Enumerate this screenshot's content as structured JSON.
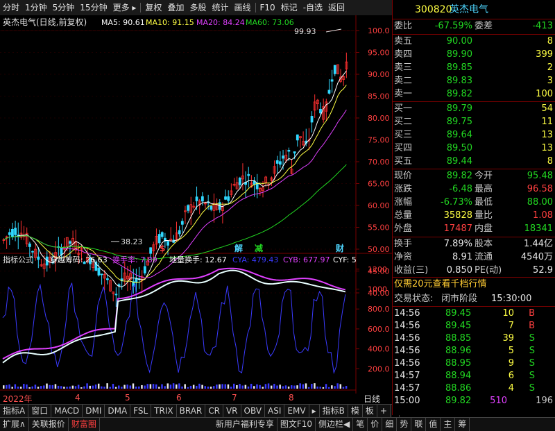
{
  "topbar": {
    "items": [
      "分时",
      "1分钟",
      "5分钟",
      "15分钟",
      "更多 ▸",
      "复权",
      "叠加",
      "多股",
      "统计",
      "画线",
      "F10",
      "标记",
      "-自选",
      "返回"
    ]
  },
  "chart": {
    "title": "英杰电气(日线,前复权)",
    "ma": [
      {
        "label": "MA5: 90.61",
        "color": "#ffffff"
      },
      {
        "label": "MA10: 91.15",
        "color": "#ffff44"
      },
      {
        "label": "MA20: 84.24",
        "color": "#e040ff"
      },
      {
        "label": "MA60: 73.06",
        "color": "#22d822"
      }
    ],
    "price_ticks": [
      "100.0",
      "95.00",
      "90.00",
      "85.00",
      "80.00",
      "75.00",
      "70.00",
      "65.00",
      "60.00",
      "55.00",
      "50.00",
      "45.00",
      "40.00"
    ],
    "high_note": "99.93",
    "low_note": "38.23",
    "markers": [
      {
        "text": "$",
        "color": "#ff4040"
      },
      {
        "text": "解",
        "color": "#4ed6ff"
      },
      {
        "text": "减",
        "color": "#22d822"
      },
      {
        "text": "财",
        "color": "#4ed6ff"
      }
    ],
    "indicator": {
      "name": "指标公式",
      "values": [
        {
          "label": "穿越筹码: 26.63",
          "color": "#ffffff"
        },
        {
          "label": "换手率:  7.89",
          "color": "#e040ff"
        },
        {
          "label": "地量换手: 12.67",
          "color": "#ffffff"
        },
        {
          "label": "CYA: 479.43",
          "color": "#3a3aff"
        },
        {
          "label": "CYB: 677.97",
          "color": "#e040ff"
        },
        {
          "label": "CYF: 5",
          "color": "#ffffff"
        }
      ],
      "ticks": [
        "1200",
        "1000",
        "800.0",
        "600.0",
        "400.0",
        "200.0"
      ]
    },
    "date_labels": [
      "2022年",
      "4",
      "5",
      "6",
      "7",
      "8"
    ],
    "period_label": "日线"
  },
  "tabs1": [
    "指标A",
    "窗口",
    "MACD",
    "DMI",
    "DMA",
    "FSL",
    "TRIX",
    "BRAR",
    "CR",
    "VR",
    "OBV",
    "ASI",
    "EMV",
    "▸",
    "指标B",
    "模",
    "板",
    "+",
    "-"
  ],
  "tabs2": [
    "扩展∧",
    "关联报价",
    "财富圈",
    "新用户福利专享",
    "图文F10",
    "侧边栏◀",
    "笔",
    "价",
    "细",
    "势",
    "联",
    "值",
    "主",
    "筹"
  ],
  "quote": {
    "code": "300820",
    "name": "英杰电气",
    "wb_label": "委比",
    "wb": "-67.59%",
    "wc_label": "委差",
    "wc": "-413",
    "asks": [
      {
        "label": "卖五",
        "price": "90.00",
        "vol": "8"
      },
      {
        "label": "卖四",
        "price": "89.90",
        "vol": "399"
      },
      {
        "label": "卖三",
        "price": "89.85",
        "vol": "2"
      },
      {
        "label": "卖二",
        "price": "89.83",
        "vol": "3"
      },
      {
        "label": "卖一",
        "price": "89.82",
        "vol": "100"
      }
    ],
    "bids": [
      {
        "label": "买一",
        "price": "89.79",
        "vol": "54"
      },
      {
        "label": "买二",
        "price": "89.75",
        "vol": "11"
      },
      {
        "label": "买三",
        "price": "89.64",
        "vol": "13"
      },
      {
        "label": "买四",
        "price": "89.50",
        "vol": "13"
      },
      {
        "label": "买五",
        "price": "89.44",
        "vol": "8"
      }
    ],
    "stats": [
      {
        "l1": "现价",
        "v1": "89.82",
        "c1": "green",
        "l2": "今开",
        "v2": "95.48",
        "c2": "green"
      },
      {
        "l1": "涨跌",
        "v1": "-6.48",
        "c1": "green",
        "l2": "最高",
        "v2": "96.58",
        "c2": "red"
      },
      {
        "l1": "涨幅",
        "v1": "-6.73%",
        "c1": "green",
        "l2": "最低",
        "v2": "88.00",
        "c2": "green"
      },
      {
        "l1": "总量",
        "v1": "35828",
        "c1": "yellow",
        "l2": "量比",
        "v2": "1.08",
        "c2": "red"
      },
      {
        "l1": "外盘",
        "v1": "17487",
        "c1": "red",
        "l2": "内盘",
        "v2": "18341",
        "c2": "green"
      }
    ],
    "stats2": [
      {
        "l1": "换手",
        "v1": "7.89%",
        "l2": "股本",
        "v2": "1.44亿"
      },
      {
        "l1": "净资",
        "v1": "8.91",
        "l2": "流通",
        "v2": "4540万"
      },
      {
        "l1": "收益(三)",
        "v1": "0.850",
        "l2": "PE(动)",
        "v2": "52.9"
      }
    ],
    "promo": "仅需20元查看千档行情",
    "status_label": "交易状态:",
    "status": "闭市阶段",
    "status_time": "15:30:00",
    "ticks": [
      {
        "t": "14:56",
        "p": "89.45",
        "v": "10",
        "f": "B"
      },
      {
        "t": "14:56",
        "p": "89.45",
        "v": "7",
        "f": "B"
      },
      {
        "t": "14:56",
        "p": "88.85",
        "v": "39",
        "f": "S"
      },
      {
        "t": "14:56",
        "p": "88.96",
        "v": "5",
        "f": "S"
      },
      {
        "t": "14:56",
        "p": "88.95",
        "v": "9",
        "f": "S"
      },
      {
        "t": "14:57",
        "p": "88.94",
        "v": "6",
        "f": "S"
      },
      {
        "t": "14:57",
        "p": "88.86",
        "v": "4",
        "f": "S"
      },
      {
        "t": "15:00",
        "p": "89.82",
        "v": "510",
        "f": "196"
      }
    ]
  }
}
